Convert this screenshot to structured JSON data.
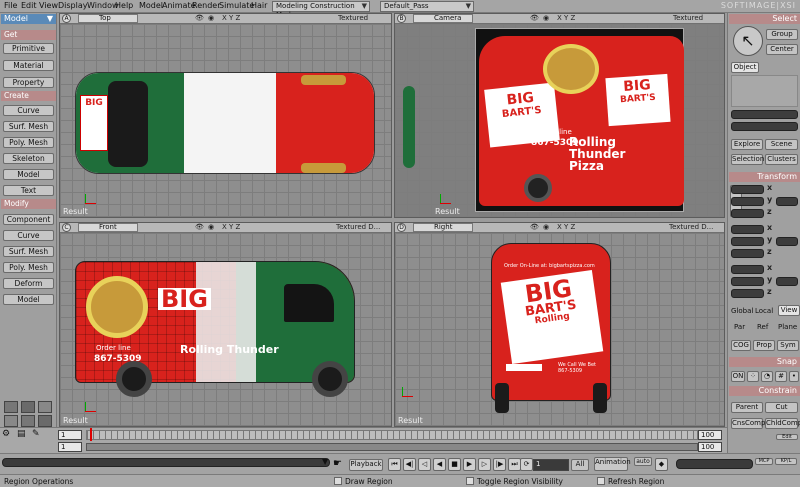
{
  "menubar": {
    "items": [
      "File",
      "Edit",
      "View",
      "Display",
      "Window",
      "Help",
      "Model",
      "Animate",
      "Render",
      "Simulate",
      "Hair"
    ],
    "mode_select": "Modeling Construction Mode",
    "pass_select": "Default_Pass",
    "brand": "SOFTIMAGE|XSI"
  },
  "left_toolbar": {
    "mode": "Model",
    "sections": [
      {
        "title": "Get",
        "buttons": [
          "Primitive",
          "Material",
          "Property"
        ]
      },
      {
        "title": "Create",
        "buttons": [
          "Curve",
          "Surf. Mesh",
          "Poly. Mesh",
          "Skeleton",
          "Model",
          "Text"
        ]
      },
      {
        "title": "Modify",
        "buttons": [
          "Component",
          "Curve",
          "Surf. Mesh",
          "Poly. Mesh",
          "Deform",
          "Model"
        ]
      }
    ]
  },
  "viewports": [
    {
      "letter": "A",
      "name": "Top",
      "mode": "Textured",
      "result": "Result"
    },
    {
      "letter": "B",
      "name": "Camera",
      "mode": "Textured",
      "result": "Result"
    },
    {
      "letter": "C",
      "name": "Front",
      "mode": "Textured D...",
      "result": "Result"
    },
    {
      "letter": "D",
      "name": "Right",
      "mode": "Textured D...",
      "result": "Result"
    }
  ],
  "viewport_icons": "X Y Z",
  "van_text": {
    "big": "BIG",
    "barts": "BART'S",
    "rolling": "Rolling",
    "thunder": "Thunder",
    "pizza": "Pizza",
    "order_line": "Order line",
    "phone": "867-5309",
    "order_online": "Order On-Line at: bigbartspizza.com",
    "call_us": "We Call We Bet"
  },
  "right_panel": {
    "select_title": "Select",
    "group_btn": "Group",
    "center_btn": "Center",
    "object_btn": "Object",
    "explore_btn": "Explore",
    "scene_btn": "Scene",
    "selection_btn": "Selection",
    "clusters_btn": "Clusters",
    "transform_title": "Transform",
    "axes": [
      "x",
      "y",
      "z"
    ],
    "global_btn": "Global",
    "local_btn": "Local",
    "view_btn": "View",
    "par_btn": "Par",
    "ref_btn": "Ref",
    "plane_btn": "Plane",
    "cog_btn": "COG",
    "prop_btn": "Prop",
    "sym_btn": "Sym",
    "snap_title": "Snap",
    "on_btn": "ON",
    "constrain_title": "Constrain",
    "parent_btn": "Parent",
    "cut_btn": "Cut",
    "cnscomp_btn": "CnsComp",
    "chldcomp_btn": "ChldComp",
    "edit_btn": "Edit"
  },
  "timeline": {
    "start": "1",
    "end": "100",
    "start2": "1",
    "end2": "100",
    "current": "1"
  },
  "playback": {
    "playback_label": "Playback",
    "frame_value": "1",
    "all_label": "All",
    "animation_label": "Animation",
    "auto_label": "auto",
    "mcp_label": "MCP",
    "kp_label": "KP/L"
  },
  "status": {
    "left": "Region Operations",
    "m1": "Draw Region",
    "m2": "Toggle Region Visibility",
    "m3": "Refresh Region"
  },
  "colors": {
    "accent_title": "#b78a8a",
    "mode_blue": "#5a8ab8",
    "van_red": "#d8221d",
    "van_green": "#1f6e3a"
  }
}
